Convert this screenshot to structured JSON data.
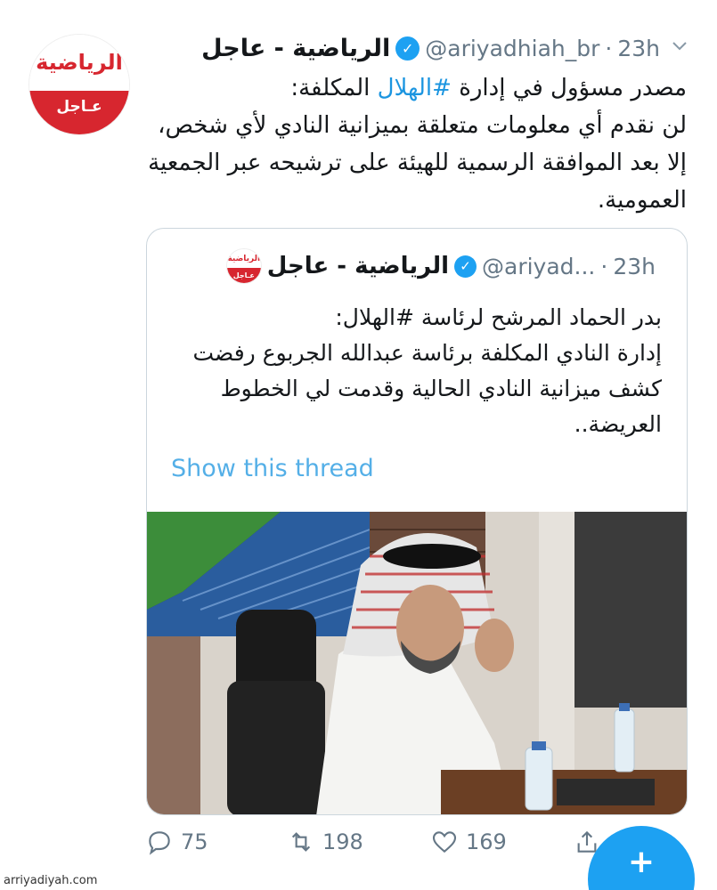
{
  "tweet": {
    "avatar_top": "الرياضية",
    "avatar_bottom": "عـاجل",
    "name": "الرياضية - عاجل",
    "handle": "@ariyadhiah_br",
    "dot": "·",
    "time": "23h",
    "text_line1_before": "مصدر مسؤول في إدارة ",
    "hashtag": "#الهلال",
    "text_line1_after": " المكلفة:",
    "text_rest": "لن نقدم أي معلومات متعلقة بميزانية النادي لأي شخص، إلا بعد الموافقة الرسمية للهيئة على ترشيحه عبر الجمعية العمومية."
  },
  "quote": {
    "name": "الرياضية - عاجل",
    "handle": "@ariyad...",
    "dot": "·",
    "time": "23h",
    "text_line1_before": "بدر الحماد المرشح لرئاسة ",
    "hashtag": "#الهلال",
    "text_line1_after": ":",
    "text_rest": "إدارة النادي المكلفة برئاسة عبدالله الجربوع رفضت كشف ميزانية النادي الحالية وقدمت لي الخطوط العريضة..",
    "show_thread": "Show this thread"
  },
  "actions": {
    "reply_count": "75",
    "retweet_count": "198",
    "like_count": "169"
  },
  "fab_label": "+",
  "watermark": "arriyadiyah.com",
  "colors": {
    "accent": "#1da1f2",
    "brand_red": "#d7262f"
  }
}
